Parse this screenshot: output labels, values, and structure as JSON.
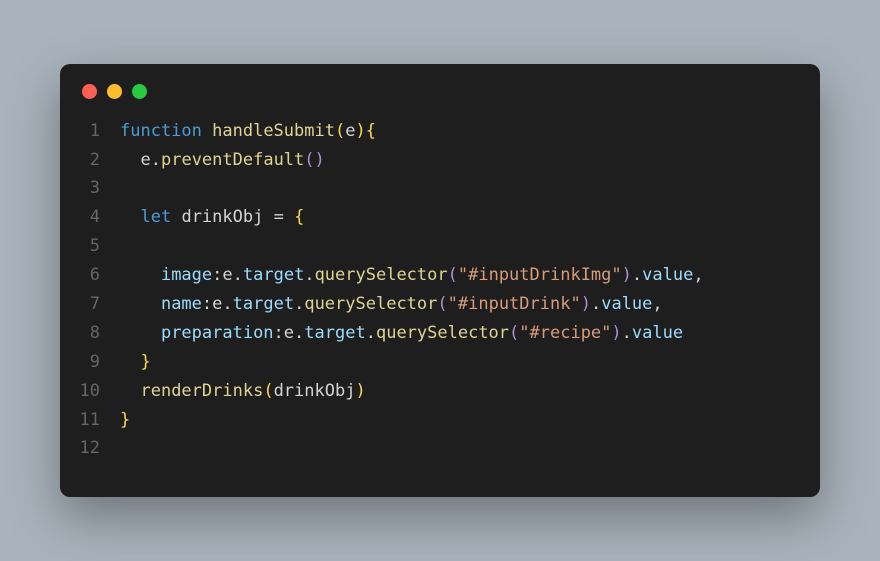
{
  "colors": {
    "bg_page": "#a9b3bd",
    "bg_window": "#1e1e1e",
    "traffic_close": "#ff5f56",
    "traffic_min": "#ffbd2e",
    "traffic_max": "#27c93f",
    "gutter": "#666666",
    "default": "#d4d4d4",
    "keyword": "#4a9cd6",
    "function": "#e0d493",
    "property": "#9cdcfe",
    "string": "#d89c7a",
    "brace": "#ffd84d",
    "paren": "#b58cd6"
  },
  "line_numbers": [
    "1",
    "2",
    "3",
    "4",
    "5",
    "6",
    "7",
    "8",
    "9",
    "10",
    "11",
    "12"
  ],
  "code": {
    "lines": [
      [
        {
          "cls": "tok-kw",
          "t": "function"
        },
        {
          "cls": "tok-punct",
          "t": " "
        },
        {
          "cls": "tok-fn",
          "t": "handleSubmit"
        },
        {
          "cls": "tok-brace",
          "t": "("
        },
        {
          "cls": "tok-id",
          "t": "e"
        },
        {
          "cls": "tok-brace",
          "t": ")"
        },
        {
          "cls": "tok-brace",
          "t": "{"
        }
      ],
      [
        {
          "cls": "tok-punct",
          "t": "  "
        },
        {
          "cls": "tok-id",
          "t": "e"
        },
        {
          "cls": "tok-punct",
          "t": "."
        },
        {
          "cls": "tok-fn",
          "t": "preventDefault"
        },
        {
          "cls": "tok-paren",
          "t": "()"
        }
      ],
      [
        {
          "cls": "tok-punct",
          "t": ""
        }
      ],
      [
        {
          "cls": "tok-punct",
          "t": "  "
        },
        {
          "cls": "tok-kw",
          "t": "let"
        },
        {
          "cls": "tok-punct",
          "t": " "
        },
        {
          "cls": "tok-id",
          "t": "drinkObj"
        },
        {
          "cls": "tok-punct",
          "t": " = "
        },
        {
          "cls": "tok-brace",
          "t": "{"
        }
      ],
      [
        {
          "cls": "tok-punct",
          "t": ""
        }
      ],
      [
        {
          "cls": "tok-punct",
          "t": "    "
        },
        {
          "cls": "tok-prop",
          "t": "image"
        },
        {
          "cls": "tok-punct",
          "t": ":"
        },
        {
          "cls": "tok-id",
          "t": "e"
        },
        {
          "cls": "tok-punct",
          "t": "."
        },
        {
          "cls": "tok-prop",
          "t": "target"
        },
        {
          "cls": "tok-punct",
          "t": "."
        },
        {
          "cls": "tok-fn",
          "t": "querySelector"
        },
        {
          "cls": "tok-paren",
          "t": "("
        },
        {
          "cls": "tok-str",
          "t": "\"#inputDrinkImg\""
        },
        {
          "cls": "tok-paren",
          "t": ")"
        },
        {
          "cls": "tok-punct",
          "t": "."
        },
        {
          "cls": "tok-prop",
          "t": "value"
        },
        {
          "cls": "tok-punct",
          "t": ","
        }
      ],
      [
        {
          "cls": "tok-punct",
          "t": "    "
        },
        {
          "cls": "tok-prop",
          "t": "name"
        },
        {
          "cls": "tok-punct",
          "t": ":"
        },
        {
          "cls": "tok-id",
          "t": "e"
        },
        {
          "cls": "tok-punct",
          "t": "."
        },
        {
          "cls": "tok-prop",
          "t": "target"
        },
        {
          "cls": "tok-punct",
          "t": "."
        },
        {
          "cls": "tok-fn",
          "t": "querySelector"
        },
        {
          "cls": "tok-paren",
          "t": "("
        },
        {
          "cls": "tok-str",
          "t": "\"#inputDrink\""
        },
        {
          "cls": "tok-paren",
          "t": ")"
        },
        {
          "cls": "tok-punct",
          "t": "."
        },
        {
          "cls": "tok-prop",
          "t": "value"
        },
        {
          "cls": "tok-punct",
          "t": ","
        }
      ],
      [
        {
          "cls": "tok-punct",
          "t": "    "
        },
        {
          "cls": "tok-prop",
          "t": "preparation"
        },
        {
          "cls": "tok-punct",
          "t": ":"
        },
        {
          "cls": "tok-id",
          "t": "e"
        },
        {
          "cls": "tok-punct",
          "t": "."
        },
        {
          "cls": "tok-prop",
          "t": "target"
        },
        {
          "cls": "tok-punct",
          "t": "."
        },
        {
          "cls": "tok-fn",
          "t": "querySelector"
        },
        {
          "cls": "tok-paren",
          "t": "("
        },
        {
          "cls": "tok-str",
          "t": "\"#recipe\""
        },
        {
          "cls": "tok-paren",
          "t": ")"
        },
        {
          "cls": "tok-punct",
          "t": "."
        },
        {
          "cls": "tok-prop",
          "t": "value"
        }
      ],
      [
        {
          "cls": "tok-punct",
          "t": "  "
        },
        {
          "cls": "tok-brace",
          "t": "}"
        }
      ],
      [
        {
          "cls": "tok-punct",
          "t": "  "
        },
        {
          "cls": "tok-fn",
          "t": "renderDrinks"
        },
        {
          "cls": "tok-brace",
          "t": "("
        },
        {
          "cls": "tok-id",
          "t": "drinkObj"
        },
        {
          "cls": "tok-brace",
          "t": ")"
        }
      ],
      [
        {
          "cls": "tok-brace",
          "t": "}"
        }
      ],
      [
        {
          "cls": "tok-punct",
          "t": ""
        }
      ]
    ]
  }
}
